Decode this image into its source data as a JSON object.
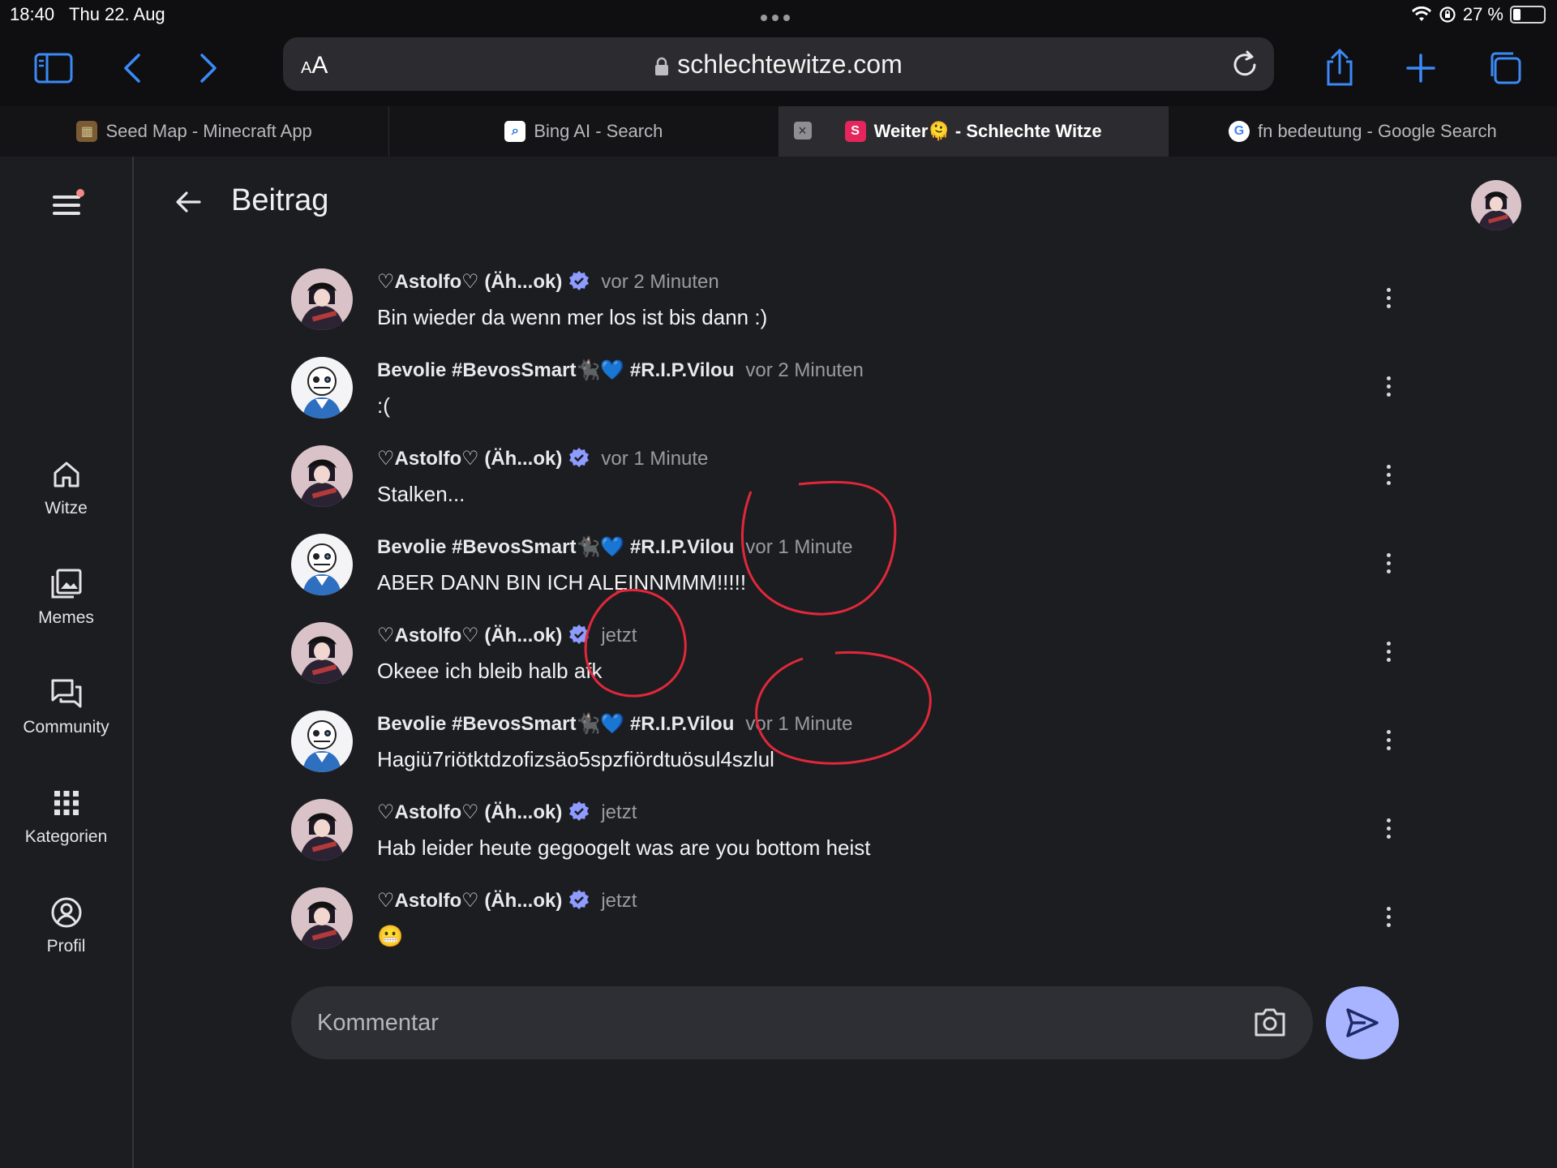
{
  "status_bar": {
    "time": "18:40",
    "date": "Thu 22. Aug",
    "battery": "27 %",
    "battery_level": 0.27
  },
  "browser": {
    "aa_label_small": "A",
    "aa_label_big": "A",
    "url": "schlechtewitze.com",
    "tabs": [
      {
        "title": "Seed Map - Minecraft App",
        "icon": "minecraft-icon"
      },
      {
        "title": "Bing AI - Search",
        "icon": "bing-icon"
      },
      {
        "title": "Weiter🫠 - Schlechte Witze",
        "icon": "schlechte-witze-icon",
        "active": true
      },
      {
        "title": "fn bedeutung - Google Search",
        "icon": "google-icon"
      }
    ]
  },
  "sidebar": {
    "items": [
      {
        "label": "Witze",
        "icon": "home-icon"
      },
      {
        "label": "Memes",
        "icon": "images-icon"
      },
      {
        "label": "Community",
        "icon": "forum-icon"
      },
      {
        "label": "Kategorien",
        "icon": "grid-icon"
      },
      {
        "label": "Profil",
        "icon": "account-icon"
      }
    ]
  },
  "header": {
    "title": "Beitrag"
  },
  "users": {
    "astolfo": {
      "name_sym_left": "♡Astolfo♡",
      "name_rest": "(Äh...ok)"
    },
    "bevolie": {
      "name": "Bevolie #BevosSmart🐈‍⬛💙 #R.I.P.Vilou"
    }
  },
  "comments": [
    {
      "user": "astolfo",
      "name": "♡Astolfo♡ (Äh...ok)",
      "verified": true,
      "time": "vor 2 Minuten",
      "text": "Bin wieder da wenn mer los ist bis dann :)"
    },
    {
      "user": "bevolie",
      "name": "Bevolie #BevosSmart🐈‍⬛💙 #R.I.P.Vilou",
      "verified": false,
      "time": "vor 2 Minuten",
      "text": ":("
    },
    {
      "user": "astolfo",
      "name": "♡Astolfo♡ (Äh...ok)",
      "verified": true,
      "time": "vor 1 Minute",
      "text": "Stalken..."
    },
    {
      "user": "bevolie",
      "name": "Bevolie #BevosSmart🐈‍⬛💙 #R.I.P.Vilou",
      "verified": false,
      "time": "vor 1 Minute",
      "text": "ABER DANN BIN ICH ALEINNMMM!!!!!"
    },
    {
      "user": "astolfo",
      "name": "♡Astolfo♡ (Äh...ok)",
      "verified": true,
      "time": "jetzt",
      "text": "Okeee ich bleib halb afk"
    },
    {
      "user": "bevolie",
      "name": "Bevolie #BevosSmart🐈‍⬛💙 #R.I.P.Vilou",
      "verified": false,
      "time": "vor 1 Minute",
      "text": "Hagiü7riötktdzofizsäo5spzfiördtuösul4szlul"
    },
    {
      "user": "astolfo",
      "name": "♡Astolfo♡ (Äh...ok)",
      "verified": true,
      "time": "jetzt",
      "text": "Hab leider heute gegoogelt was are you bottom heist"
    },
    {
      "user": "astolfo",
      "name": "♡Astolfo♡ (Äh...ok)",
      "verified": true,
      "time": "jetzt",
      "text": "😬"
    }
  ],
  "composer": {
    "placeholder": "Kommentar"
  },
  "colors": {
    "accent": "#a8b4ff",
    "verified": "#8e9bff",
    "annotation": "#e0283a",
    "background": "#1c1d21"
  }
}
